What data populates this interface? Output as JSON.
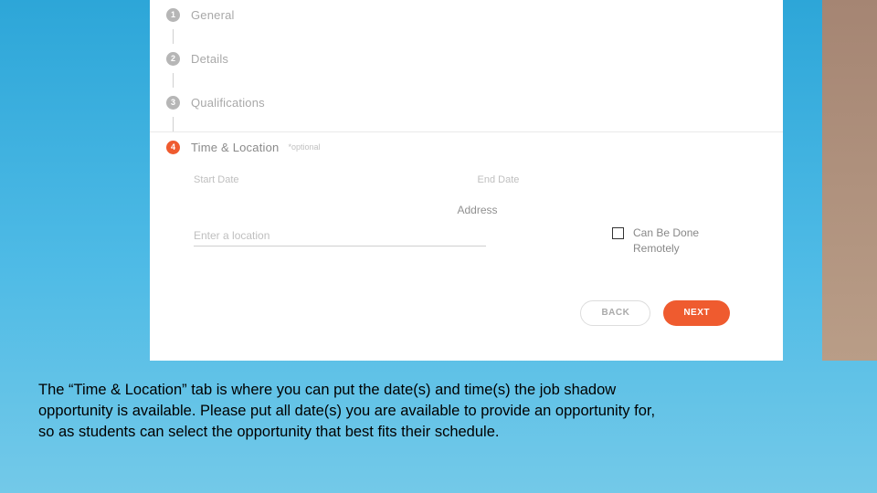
{
  "steps": [
    {
      "num": "1",
      "label": "General"
    },
    {
      "num": "2",
      "label": "Details"
    },
    {
      "num": "3",
      "label": "Qualifications"
    },
    {
      "num": "4",
      "label": "Time & Location",
      "optional": "*optional"
    }
  ],
  "fields": {
    "start_date_label": "Start Date",
    "end_date_label": "End Date",
    "address_heading": "Address",
    "location_placeholder": "Enter a location",
    "remote_label": "Can Be Done Remotely"
  },
  "buttons": {
    "back": "BACK",
    "next": "NEXT"
  },
  "caption": "The “Time & Location” tab is where you can put the date(s) and time(s) the job shadow opportunity is available. Please put all date(s) you are available to provide an opportunity for, so as students can select the opportunity that best fits their schedule."
}
